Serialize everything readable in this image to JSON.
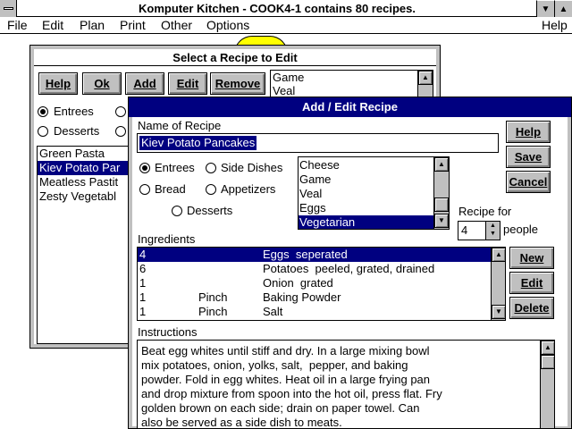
{
  "app": {
    "title": "Komputer Kitchen - COOK4-1 contains 80 recipes.",
    "menu": [
      "File",
      "Edit",
      "Plan",
      "Print",
      "Other",
      "Options"
    ],
    "help_menu": "Help"
  },
  "select_window": {
    "title": "Select a Recipe to Edit",
    "buttons": [
      "Help",
      "Ok",
      "Add",
      "Edit",
      "Remove"
    ],
    "categories_visible": [
      "Game",
      "Veal"
    ],
    "radios": [
      "Entrees",
      "Desserts"
    ],
    "recipes": [
      "Green Pasta",
      "Kiev Potato Par",
      "Meatless Pastit",
      "Zesty Vegetabl"
    ],
    "selected_recipe_index": 1
  },
  "dialog": {
    "title": "Add / Edit Recipe",
    "name_label": "Name of Recipe",
    "name_value": "Kiev Potato Pancakes",
    "buttons": {
      "help": "Help",
      "save": "Save",
      "cancel": "Cancel",
      "new": "New",
      "edit": "Edit",
      "delete": "Delete"
    },
    "types": [
      "Entrees",
      "Side Dishes",
      "Bread",
      "Appetizers",
      "Desserts"
    ],
    "selected_type": "Entrees",
    "categories": [
      "Cheese",
      "Game",
      "Veal",
      "Eggs",
      "Vegetarian"
    ],
    "selected_category": "Vegetarian",
    "recipe_for_label": "Recipe for",
    "servings": "4",
    "people_label": "people",
    "ingredients_label": "Ingredients",
    "ingredients": [
      {
        "qty": "4",
        "unit": "",
        "item": "Eggs  seperated"
      },
      {
        "qty": "6",
        "unit": "",
        "item": "Potatoes  peeled, grated, drained"
      },
      {
        "qty": "1",
        "unit": "",
        "item": "Onion  grated"
      },
      {
        "qty": "1",
        "unit": "Pinch",
        "item": "Baking Powder"
      },
      {
        "qty": "1",
        "unit": "Pinch",
        "item": "Salt"
      }
    ],
    "instructions_label": "Instructions",
    "instructions": [
      "Beat egg whites until stiff and dry. In a large mixing bowl",
      "mix potatoes, onion, yolks, salt,  pepper, and baking",
      "powder. Fold in egg whites. Heat oil in a large frying pan",
      "and drop mixture from spoon into the hot oil, press flat. Fry",
      "golden brown on each side; drain on paper towel. Can",
      "also be served as a side dish to meats."
    ]
  },
  "colors": {
    "selection": "#000080",
    "face": "#c0c0c0",
    "accent_circle": "#ffff00"
  }
}
